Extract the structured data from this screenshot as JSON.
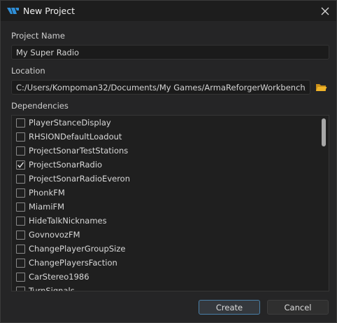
{
  "window": {
    "title": "New Project",
    "icon": "workbench-logo-icon",
    "close_icon": "close-icon"
  },
  "project_name": {
    "label": "Project Name",
    "value": "My Super Radio"
  },
  "location": {
    "label": "Location",
    "value": "C:/Users/Kompoman32/Documents/My Games/ArmaReforgerWorkbench/addons",
    "browse_icon": "folder-icon",
    "browse_icon_color": "#f0b429"
  },
  "dependencies": {
    "label": "Dependencies",
    "items": [
      {
        "name": "PlayerStanceDisplay",
        "checked": false
      },
      {
        "name": "RHSIONDefaultLoadout",
        "checked": false
      },
      {
        "name": "ProjectSonarTestStations",
        "checked": false
      },
      {
        "name": "ProjectSonarRadio",
        "checked": true
      },
      {
        "name": "ProjectSonarRadioEveron",
        "checked": false
      },
      {
        "name": "PhonkFM",
        "checked": false
      },
      {
        "name": "MiamiFM",
        "checked": false
      },
      {
        "name": "HideTalkNicknames",
        "checked": false
      },
      {
        "name": "GovnovozFM",
        "checked": false
      },
      {
        "name": "ChangePlayerGroupSize",
        "checked": false
      },
      {
        "name": "ChangePlayersFaction",
        "checked": false
      },
      {
        "name": "CarStereo1986",
        "checked": false
      },
      {
        "name": "TurnSignals",
        "checked": false
      }
    ]
  },
  "buttons": {
    "create": "Create",
    "cancel": "Cancel"
  },
  "colors": {
    "accent": "#4a7fa7",
    "background": "#252526",
    "titlebar": "#1d1d1d"
  }
}
